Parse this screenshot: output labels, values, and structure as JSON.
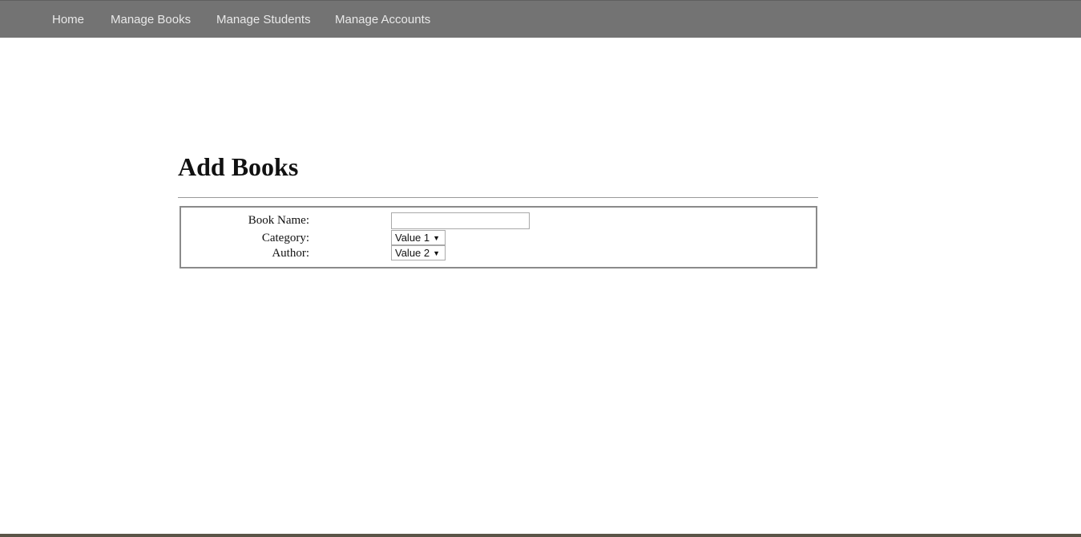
{
  "nav": {
    "items": [
      {
        "label": "Home"
      },
      {
        "label": "Manage Books"
      },
      {
        "label": "Manage Students"
      },
      {
        "label": "Manage Accounts"
      }
    ]
  },
  "page": {
    "title": "Add Books"
  },
  "form": {
    "book_name": {
      "label": "Book Name:",
      "value": ""
    },
    "category": {
      "label": "Category:",
      "selected": "Value 1"
    },
    "author": {
      "label": "Author:",
      "selected": "Value 2"
    }
  },
  "colors": {
    "navbar_bg": "#737373",
    "nav_text": "#e9e9e9",
    "page_bg": "#ffffff"
  }
}
